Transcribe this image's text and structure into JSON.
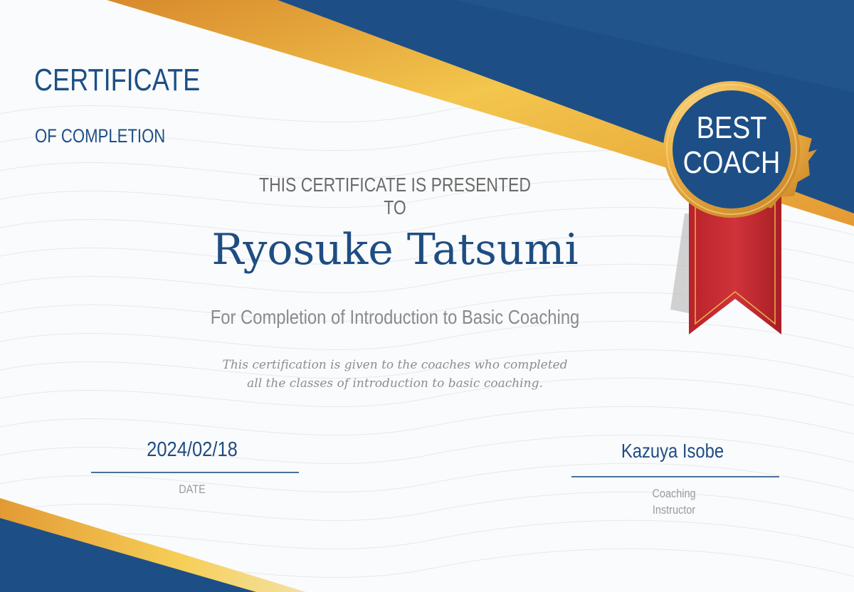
{
  "certificate": {
    "title": "CERTIFICATE",
    "subtitle": "OF COMPLETION",
    "presented_to": "THIS CERTIFICATE IS PRESENTED TO",
    "recipient": "Ryosuke Tatsumi",
    "course": "For Completion of Introduction to Basic Coaching",
    "description_line1": "This certification is given to the coaches who completed",
    "description_line2": "all the classes of introduction to basic coaching."
  },
  "date": {
    "value": "2024/02/18",
    "label": "DATE"
  },
  "signature": {
    "name": "Kazuya Isobe",
    "label_line1": "Coaching",
    "label_line2": "Instructor"
  },
  "badge": {
    "line1": "BEST",
    "line2": "COACH"
  },
  "colors": {
    "navy": "#1d4f86",
    "gold": "#e8a33a",
    "ribbon_red": "#c0272d",
    "text_gray": "#6b6b6b"
  },
  "icons": [
    "award-seal-icon",
    "ribbon-icon"
  ]
}
